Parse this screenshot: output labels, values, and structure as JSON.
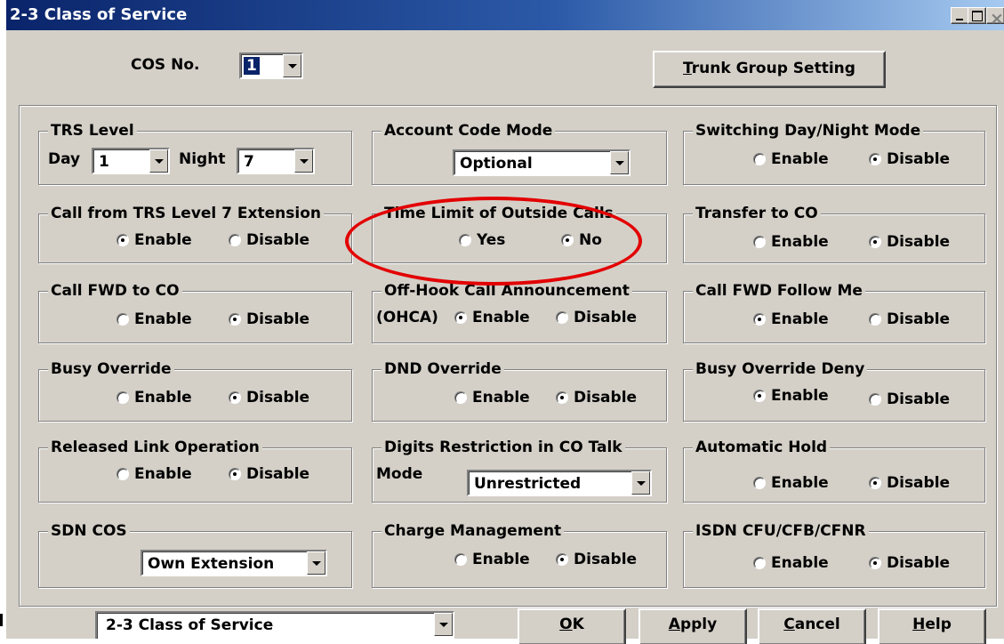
{
  "window": {
    "title": "2-3 Class of Service"
  },
  "header": {
    "cos_label": "COS No.",
    "cos_value": "1",
    "trunk_button": {
      "underline": "T",
      "rest": "runk Group Setting"
    }
  },
  "groups": {
    "trs": {
      "title": "TRS Level",
      "day_label": "Day",
      "day_value": "1",
      "night_label": "Night",
      "night_value": "7"
    },
    "account": {
      "title": "Account Code Mode",
      "value": "Optional"
    },
    "switching": {
      "title": "Switching Day/Night Mode",
      "opt1": "Enable",
      "opt2": "Disable",
      "selected": "Disable"
    },
    "call_trs7": {
      "title": "Call from TRS Level 7 Extension",
      "opt1": "Enable",
      "opt2": "Disable",
      "selected": "Enable"
    },
    "time_limit": {
      "title": "Time Limit of Outside Calls",
      "opt1": "Yes",
      "opt2": "No",
      "selected": "No"
    },
    "transfer_co": {
      "title": "Transfer to CO",
      "opt1": "Enable",
      "opt2": "Disable",
      "selected": "Disable"
    },
    "call_fwd_co": {
      "title": "Call FWD to CO",
      "opt1": "Enable",
      "opt2": "Disable",
      "selected": "Disable"
    },
    "ohca": {
      "title": "Off-Hook Call Announcement",
      "prefix": "(OHCA)",
      "opt1": "Enable",
      "opt2": "Disable",
      "selected": "Enable"
    },
    "follow_me": {
      "title": "Call FWD Follow Me",
      "opt1": "Enable",
      "opt2": "Disable",
      "selected": "Enable"
    },
    "busy_override": {
      "title": "Busy Override",
      "opt1": "Enable",
      "opt2": "Disable",
      "selected": "Disable"
    },
    "dnd_override": {
      "title": "DND Override",
      "opt1": "Enable",
      "opt2": "Disable",
      "selected": "Disable"
    },
    "busy_deny": {
      "title": "Busy Override Deny",
      "opt1": "Enable",
      "opt2": "Disable",
      "selected": "Enable"
    },
    "released_link": {
      "title": "Released Link Operation",
      "opt1": "Enable",
      "opt2": "Disable",
      "selected": "Disable"
    },
    "digits": {
      "title": "Digits Restriction in CO Talk",
      "mode_label": "Mode",
      "value": "Unrestricted"
    },
    "auto_hold": {
      "title": "Automatic Hold",
      "opt1": "Enable",
      "opt2": "Disable",
      "selected": "Disable"
    },
    "sdn_cos": {
      "title": "SDN COS",
      "value": "Own Extension"
    },
    "charge": {
      "title": "Charge Management",
      "opt1": "Enable",
      "opt2": "Disable",
      "selected": "Disable"
    },
    "isdn": {
      "title": "ISDN CFU/CFB/CFNR",
      "opt1": "Enable",
      "opt2": "Disable",
      "selected": "Disable"
    }
  },
  "footer": {
    "page_select": "2-3 Class of Service",
    "ok": {
      "underline": "O",
      "rest": "K"
    },
    "apply": {
      "underline": "A",
      "rest": "pply"
    },
    "cancel": {
      "underline": "C",
      "rest": "ancel"
    },
    "help": {
      "underline": "H",
      "rest": "elp"
    }
  },
  "annotation_color": "#e30000"
}
